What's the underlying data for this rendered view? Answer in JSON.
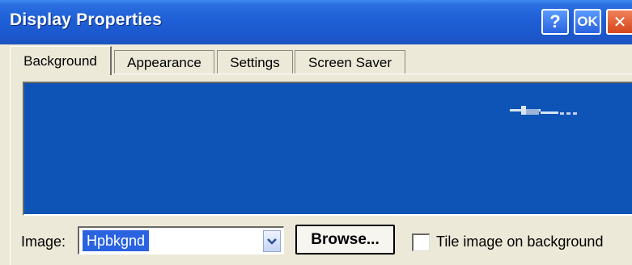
{
  "window": {
    "title": "Display Properties",
    "help_label": "?",
    "ok_label": "OK",
    "close_label": "✕"
  },
  "tabs": [
    {
      "label": "Background",
      "active": true
    },
    {
      "label": "Appearance",
      "active": false
    },
    {
      "label": "Settings",
      "active": false
    },
    {
      "label": "Screen Saver",
      "active": false
    }
  ],
  "background_tab": {
    "preview_color": "#0e54b6",
    "image_label": "Image:",
    "image_value": "Hpbkgnd",
    "browse_label": "Browse...",
    "tile_label": "Tile image on background",
    "tile_checked": false
  },
  "icons": {
    "dropdown": "chevron-down-icon",
    "logo": "hp-logo-icon"
  }
}
